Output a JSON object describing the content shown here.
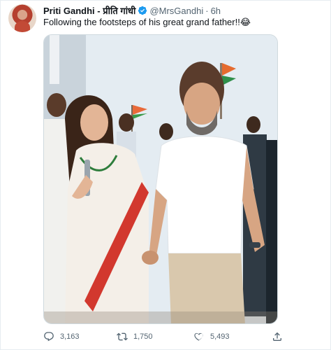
{
  "tweet": {
    "author": {
      "display_name": "Priti Gandhi - प्रीति गांधी",
      "handle": "@MrsGandhi",
      "time": "6h"
    },
    "separator": "·",
    "text": "Following the footsteps of his great grand father!!😂",
    "stats": {
      "replies": "3,163",
      "retweets": "1,750",
      "likes": "5,493"
    }
  },
  "icons": [
    "avatar",
    "verified-badge-icon",
    "reply-icon",
    "retweet-icon",
    "like-icon",
    "share-icon"
  ],
  "colors": {
    "text": "#0f1419",
    "secondary": "#536471",
    "verified": "#1d9bf0",
    "border": "#e6ecf0"
  }
}
